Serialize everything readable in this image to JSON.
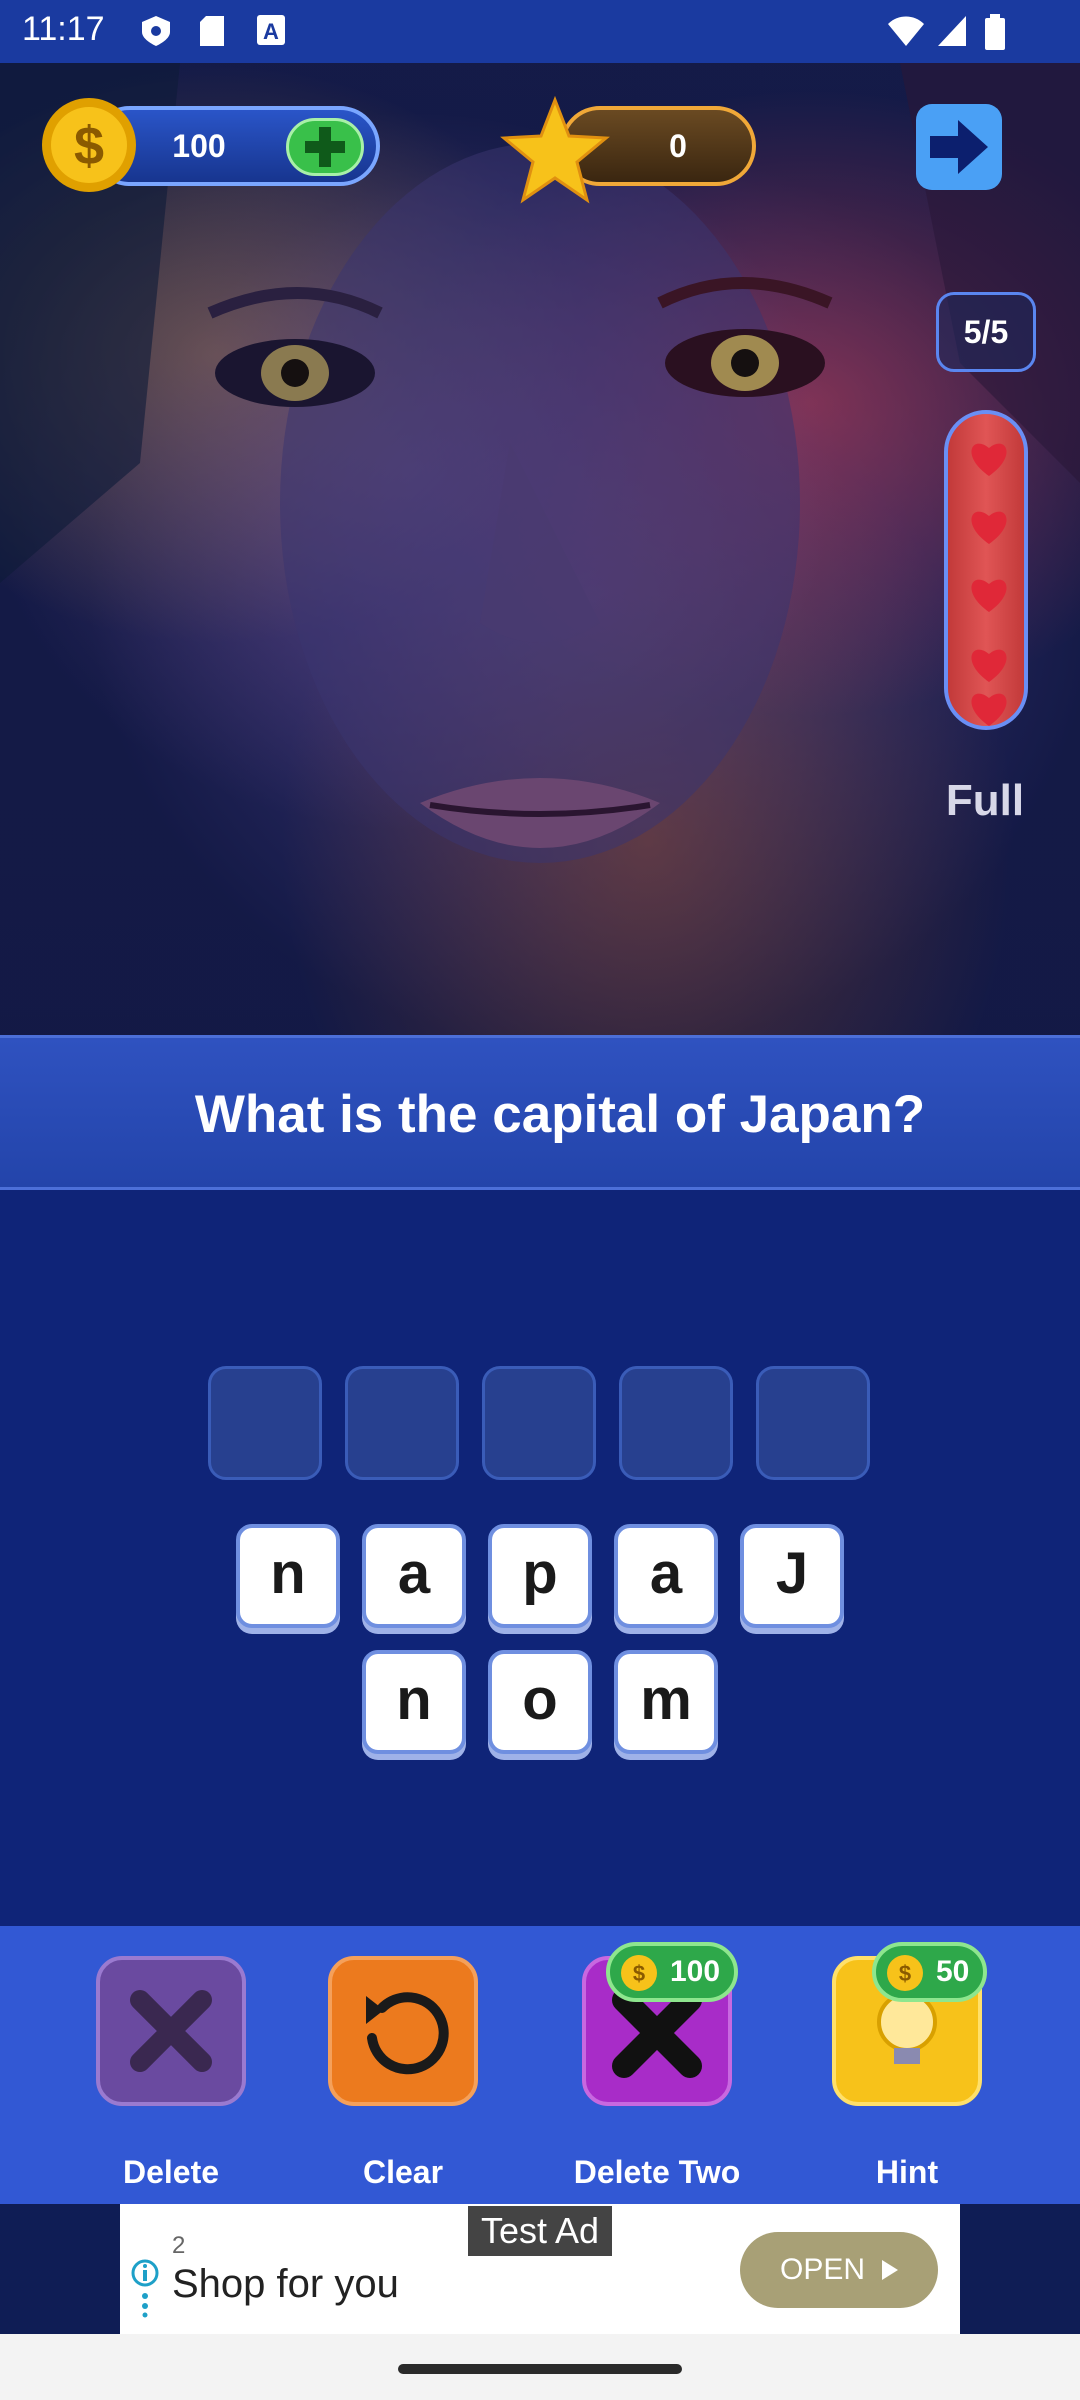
{
  "status_bar": {
    "time": "11:17"
  },
  "hud": {
    "coins": "100",
    "stars": "0"
  },
  "lives": {
    "count": "5/5",
    "status": "Full",
    "hearts": 5
  },
  "question": {
    "text": "What is the capital of Japan?"
  },
  "answer_slots": 5,
  "letters": {
    "row1": [
      "n",
      "a",
      "p",
      "a",
      "J"
    ],
    "row2": [
      "n",
      "o",
      "m"
    ]
  },
  "toolbar": {
    "delete_label": "Delete",
    "clear_label": "Clear",
    "delete_two_label": "Delete Two",
    "delete_two_cost": "100",
    "hint_label": "Hint",
    "hint_cost": "50"
  },
  "ad": {
    "tag": "Test Ad",
    "number": "2",
    "title": "Shop for you",
    "cta": "OPEN"
  },
  "colors": {
    "accent": "#3258d4",
    "background": "#0f2478",
    "coin": "#f5b800",
    "heart": "#e03040"
  }
}
